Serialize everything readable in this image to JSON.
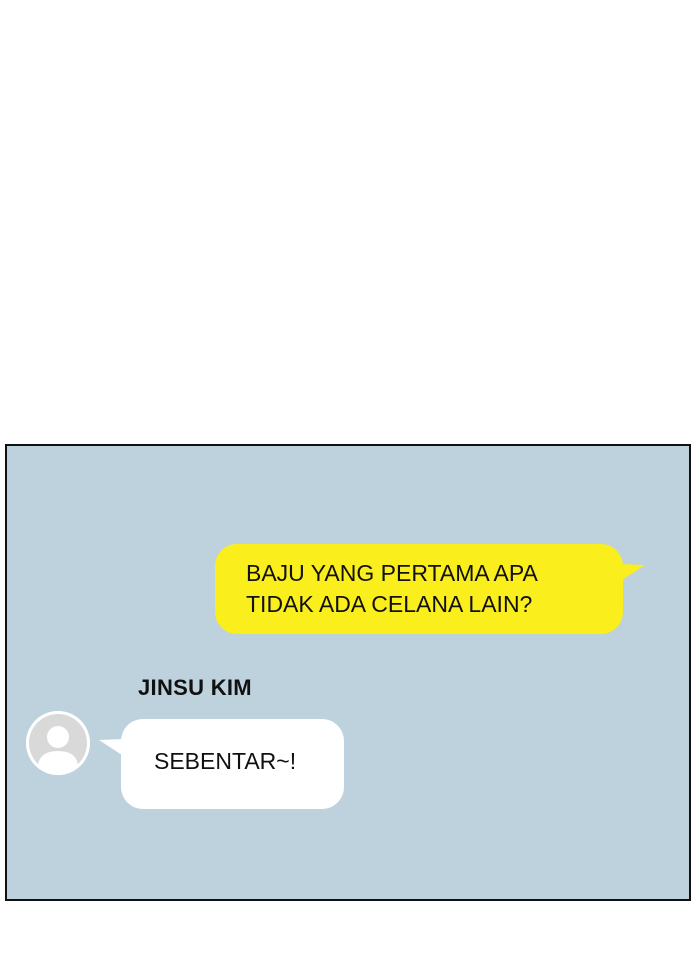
{
  "chat": {
    "outgoing": {
      "lines": [
        "BAJU YANG PERTAMA APA",
        "TIDAK ADA CELANA LAIN?"
      ],
      "bubble_color": "#fbee1d"
    },
    "incoming": {
      "sender": "JINSU KIM",
      "text": "SEBENTAR~!",
      "bubble_color": "#ffffff",
      "avatar_icon": "default-user-avatar-icon"
    },
    "background_color": "#bed2de"
  }
}
